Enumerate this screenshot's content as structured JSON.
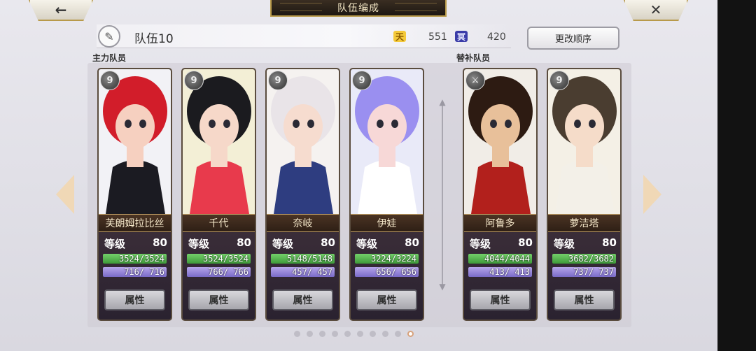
{
  "header": {
    "title": "队伍编成",
    "back_icon": "←",
    "close_icon": "✕"
  },
  "team": {
    "name": "队伍10",
    "edit_icon": "✎",
    "resources": [
      {
        "icon": "天",
        "value": "551",
        "color": "#f4c93a"
      },
      {
        "icon": "冥",
        "value": "420",
        "color": "#3b3ca8"
      }
    ],
    "reorder_label": "更改顺序"
  },
  "sections": {
    "main_label": "主力队员",
    "sub_label": "替补队员"
  },
  "stat_labels": {
    "level": "等级",
    "attribute": "属性"
  },
  "cards": [
    {
      "name": "芙朗姆拉比丝",
      "class_icon": "9",
      "level": "80",
      "hp": "3524/3524",
      "mp": "716/ 716",
      "hp_ratio": 1,
      "mp_ratio": 1,
      "palette": [
        "#f2f2f6",
        "#d21d2a",
        "#1b1b22",
        "#f6d0c0"
      ]
    },
    {
      "name": "千代",
      "class_icon": "9",
      "level": "80",
      "hp": "3524/3524",
      "mp": "766/ 766",
      "hp_ratio": 1,
      "mp_ratio": 1,
      "palette": [
        "#f3efd6",
        "#1b1b1f",
        "#e83a4c",
        "#f6d8c9"
      ]
    },
    {
      "name": "奈岐",
      "class_icon": "9",
      "level": "80",
      "hp": "5148/5148",
      "mp": "457/ 457",
      "hp_ratio": 1,
      "mp_ratio": 1,
      "palette": [
        "#f5f2f0",
        "#e9e4e8",
        "#2e3d80",
        "#f6dccf"
      ]
    },
    {
      "name": "伊娃",
      "class_icon": "9",
      "level": "80",
      "hp": "3224/3224",
      "mp": "656/ 656",
      "hp_ratio": 1,
      "mp_ratio": 1,
      "palette": [
        "#e9eaf8",
        "#9a8ff0",
        "#ffffff",
        "#f7d8d7"
      ]
    },
    {
      "name": "阿鲁多",
      "class_icon": "⚔",
      "level": "80",
      "hp": "4044/4044",
      "mp": "413/ 413",
      "hp_ratio": 1,
      "mp_ratio": 1,
      "palette": [
        "#f1ede7",
        "#2d1b12",
        "#b2201c",
        "#e8c09a"
      ]
    },
    {
      "name": "萝洁塔",
      "class_icon": "9",
      "level": "80",
      "hp": "3682/3682",
      "mp": "737/ 737",
      "hp_ratio": 1,
      "mp_ratio": 1,
      "palette": [
        "#f4f0e6",
        "#4a3d30",
        "#f3f0e8",
        "#f5dcc9"
      ]
    }
  ],
  "pager": {
    "count": 10,
    "active_index": 9
  }
}
